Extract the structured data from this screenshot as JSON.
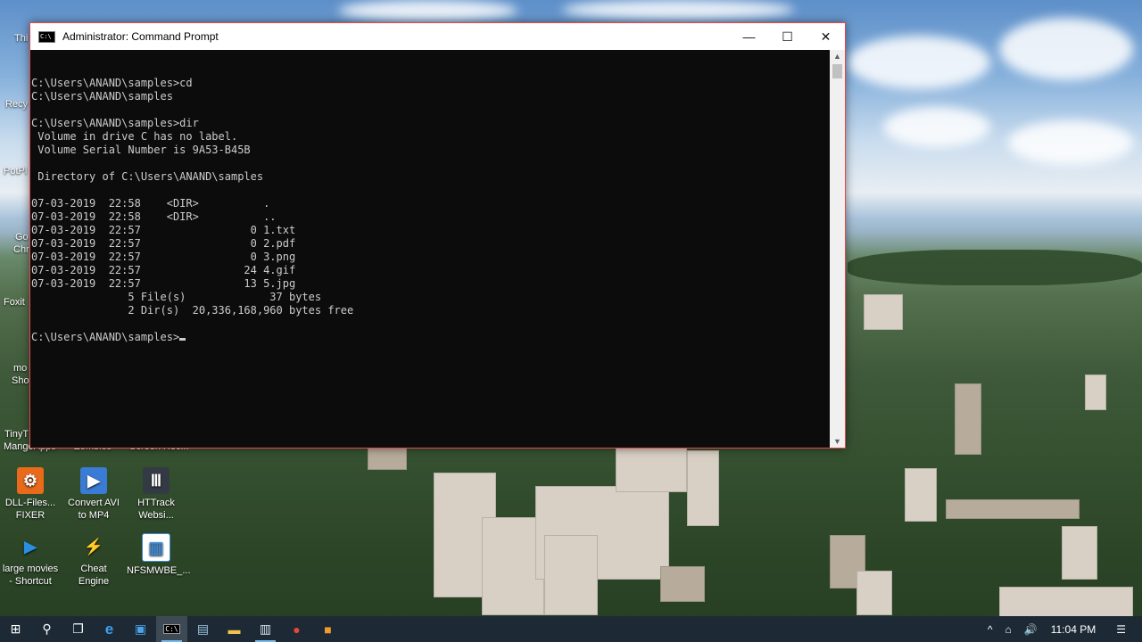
{
  "window": {
    "title": "Administrator: Command Prompt",
    "console_lines": [
      "",
      "C:\\Users\\ANAND\\samples>cd",
      "C:\\Users\\ANAND\\samples",
      "",
      "C:\\Users\\ANAND\\samples>dir",
      " Volume in drive C has no label.",
      " Volume Serial Number is 9A53-B45B",
      "",
      " Directory of C:\\Users\\ANAND\\samples",
      "",
      "07-03-2019  22:58    <DIR>          .",
      "07-03-2019  22:58    <DIR>          ..",
      "07-03-2019  22:57                 0 1.txt",
      "07-03-2019  22:57                 0 2.pdf",
      "07-03-2019  22:57                 0 3.png",
      "07-03-2019  22:57                24 4.gif",
      "07-03-2019  22:57                13 5.jpg",
      "               5 File(s)             37 bytes",
      "               2 Dir(s)  20,336,168,960 bytes free",
      ""
    ],
    "prompt": "C:\\Users\\ANAND\\samples>",
    "minimize_glyph": "—",
    "maximize_glyph": "☐",
    "close_glyph": "✕"
  },
  "desktop": {
    "edge_labels": [
      "Thi",
      "Recy",
      "PotPl",
      "Go",
      "Chr",
      "Foxit",
      "mo",
      "Sho",
      "TinyT",
      "MangoApps",
      "Zombies",
      "Screen Rec..."
    ],
    "icons": [
      {
        "label": "DLL-Files... FIXER",
        "icon": "gear-icon",
        "color": "#e86a1a"
      },
      {
        "label": "Convert AVI to MP4",
        "icon": "video-icon",
        "color": "#3a7bd5"
      },
      {
        "label": "HTTrack Websi...",
        "icon": "httrack-icon",
        "color": "#333a44"
      },
      {
        "label": "large movies - Shortcut",
        "icon": "play-icon",
        "color": "#2a8fe0"
      },
      {
        "label": "Cheat Engine",
        "icon": "cheat-engine-icon",
        "color": "#3b6cb0"
      },
      {
        "label": "NFSMWBE_...",
        "icon": "window-icon",
        "color": "#3a8ad8"
      }
    ]
  },
  "taskbar": {
    "items": [
      {
        "name": "start-icon",
        "glyph": "⊞"
      },
      {
        "name": "search-icon",
        "glyph": "⚲"
      },
      {
        "name": "task-view-icon",
        "glyph": "❐"
      },
      {
        "name": "edge-icon",
        "glyph": "e"
      },
      {
        "name": "app-icon",
        "glyph": "▣"
      },
      {
        "name": "cmd-icon",
        "glyph": "C:\\"
      },
      {
        "name": "app2-icon",
        "glyph": "▤"
      },
      {
        "name": "folder-icon",
        "glyph": "▬"
      },
      {
        "name": "app3-icon",
        "glyph": "▥"
      },
      {
        "name": "media-icon",
        "glyph": "●"
      },
      {
        "name": "app4-icon",
        "glyph": "■"
      }
    ],
    "tray_chevron": "^",
    "network_glyph": "⌂",
    "volume_glyph": "🔊",
    "clock": "11:04 PM",
    "notifications_glyph": "☰"
  },
  "colors": {
    "window_border": "#e8474a",
    "console_bg": "#0c0c0c",
    "console_text": "#cccccc",
    "taskbar_bg": "#1d2a35"
  }
}
